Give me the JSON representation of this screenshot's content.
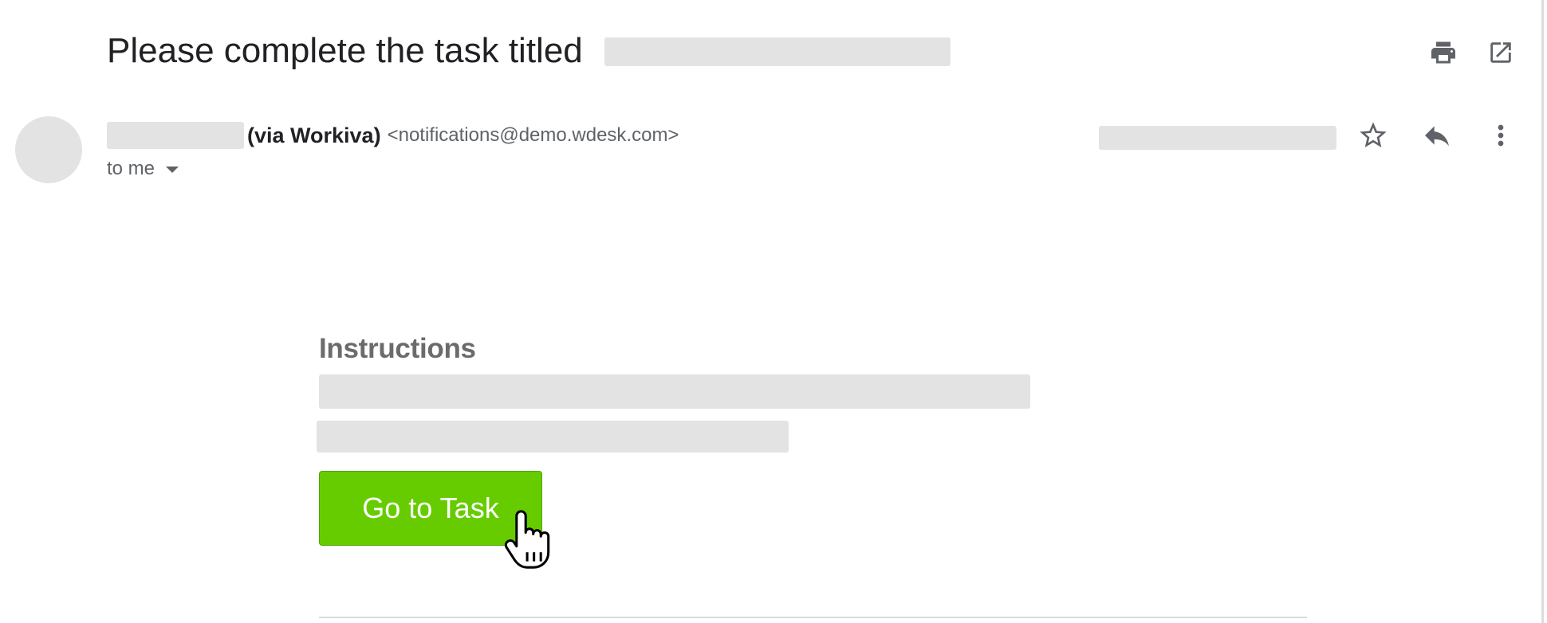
{
  "email": {
    "subject_prefix": "Please complete the task titled",
    "sender": {
      "via_label": "(via Workiva)",
      "address": "<notifications@demo.wdesk.com>"
    },
    "recipient_label": "to me",
    "body": {
      "heading": "Instructions",
      "button_label": "Go to Task"
    }
  },
  "icons": {
    "top": [
      "printer-icon",
      "open-in-new-window-icon"
    ],
    "header": [
      "star-icon",
      "reply-icon",
      "more-vertical-icon"
    ]
  },
  "colors": {
    "button_bg": "#66cc00",
    "heading_text": "#6b6b6b",
    "icon_color": "#5f6368",
    "redaction": "#e3e3e3"
  }
}
